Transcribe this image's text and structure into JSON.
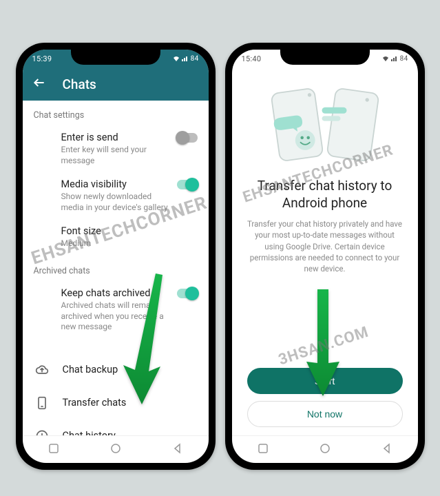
{
  "left": {
    "status_time": "15:39",
    "status_icons": "84",
    "appbar_title": "Chats",
    "section_chat_settings": "Chat settings",
    "enter_is_send": {
      "title": "Enter is send",
      "sub": "Enter key will send your message"
    },
    "media_visibility": {
      "title": "Media visibility",
      "sub": "Show newly downloaded media in your device's gallery"
    },
    "font_size": {
      "title": "Font size",
      "sub": "Medium"
    },
    "section_archived": "Archived chats",
    "keep_archived": {
      "title": "Keep chats archived",
      "sub": "Archived chats will remain archived when you receive a new message"
    },
    "chat_backup": "Chat backup",
    "transfer_chats": "Transfer chats",
    "chat_history": "Chat history"
  },
  "right": {
    "status_time": "15:40",
    "status_icons": "84",
    "title": "Transfer chat history to Android phone",
    "desc": "Transfer your chat history privately and have your most up-to-date messages without using Google Drive. Certain device permissions are needed to connect to your new device.",
    "start": "Start",
    "not_now": "Not now"
  },
  "watermarks": {
    "w1": "EHSANTECHCORNER",
    "w2": "EHSANTECHCORNER",
    "w3": "3HSAN.COM"
  }
}
